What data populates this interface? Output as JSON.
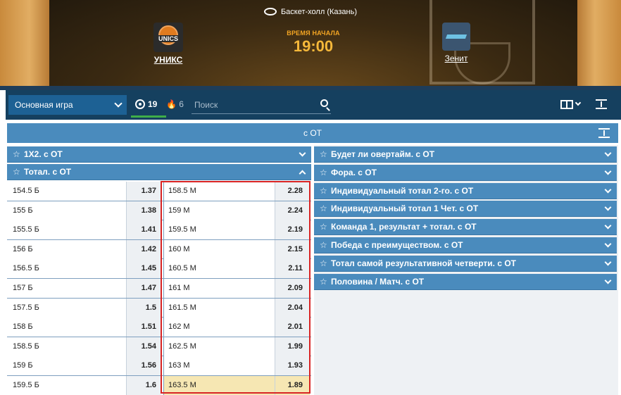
{
  "match": {
    "venue": "Баскет-холл (Казань)",
    "home_team": "УНИКС",
    "home_logo_text": "UNICS",
    "away_team": "Зенит",
    "start_label": "ВРЕМЯ НАЧАЛА",
    "start_time": "19:00"
  },
  "toolbar": {
    "game_select": "Основная игра",
    "count_all": "19",
    "count_live": "6",
    "search_placeholder": "Поиск"
  },
  "section": {
    "title": "с ОТ"
  },
  "left_markets": [
    {
      "label": "1X2. с ОТ",
      "expanded": false
    },
    {
      "label": "Тотал. с ОТ",
      "expanded": true
    }
  ],
  "right_markets": [
    {
      "label": "Будет ли овертайм. с ОТ"
    },
    {
      "label": "Фора. с ОТ"
    },
    {
      "label": "Индивидуальный тотал 2-го. с ОТ"
    },
    {
      "label": "Индивидуальный тотал 1 Чет. с ОТ"
    },
    {
      "label": "Команда 1, результат + тотал. с ОТ"
    },
    {
      "label": "Победа с преимуществом. с ОТ"
    },
    {
      "label": "Тотал самой результативной четверти. с ОТ"
    },
    {
      "label": "Половина / Матч. с ОТ"
    }
  ],
  "totals": [
    {
      "over": "154.5 Б",
      "over_odd": "1.37",
      "under": "158.5 М",
      "under_odd": "2.28"
    },
    {
      "over": "155 Б",
      "over_odd": "1.38",
      "under": "159 М",
      "under_odd": "2.24"
    },
    {
      "over": "155.5 Б",
      "over_odd": "1.41",
      "under": "159.5 М",
      "under_odd": "2.19"
    },
    {
      "over": "156 Б",
      "over_odd": "1.42",
      "under": "160 М",
      "under_odd": "2.15"
    },
    {
      "over": "156.5 Б",
      "over_odd": "1.45",
      "under": "160.5 М",
      "under_odd": "2.11"
    },
    {
      "over": "157 Б",
      "over_odd": "1.47",
      "under": "161 М",
      "under_odd": "2.09"
    },
    {
      "over": "157.5 Б",
      "over_odd": "1.5",
      "under": "161.5 М",
      "under_odd": "2.04"
    },
    {
      "over": "158 Б",
      "over_odd": "1.51",
      "under": "162 М",
      "under_odd": "2.01"
    },
    {
      "over": "158.5 Б",
      "over_odd": "1.54",
      "under": "162.5 М",
      "under_odd": "1.99"
    },
    {
      "over": "159 Б",
      "over_odd": "1.56",
      "under": "163 М",
      "under_odd": "1.93"
    },
    {
      "over": "159.5 Б",
      "over_odd": "1.6",
      "under": "163.5 М",
      "under_odd": "1.89",
      "highlighted": true
    }
  ],
  "colors": {
    "header_blue": "#4a8bbd",
    "toolbar_dark": "#15405f",
    "accent_orange": "#f5a623",
    "highlight": "#f6e7b3",
    "frame_red": "#d82424"
  }
}
